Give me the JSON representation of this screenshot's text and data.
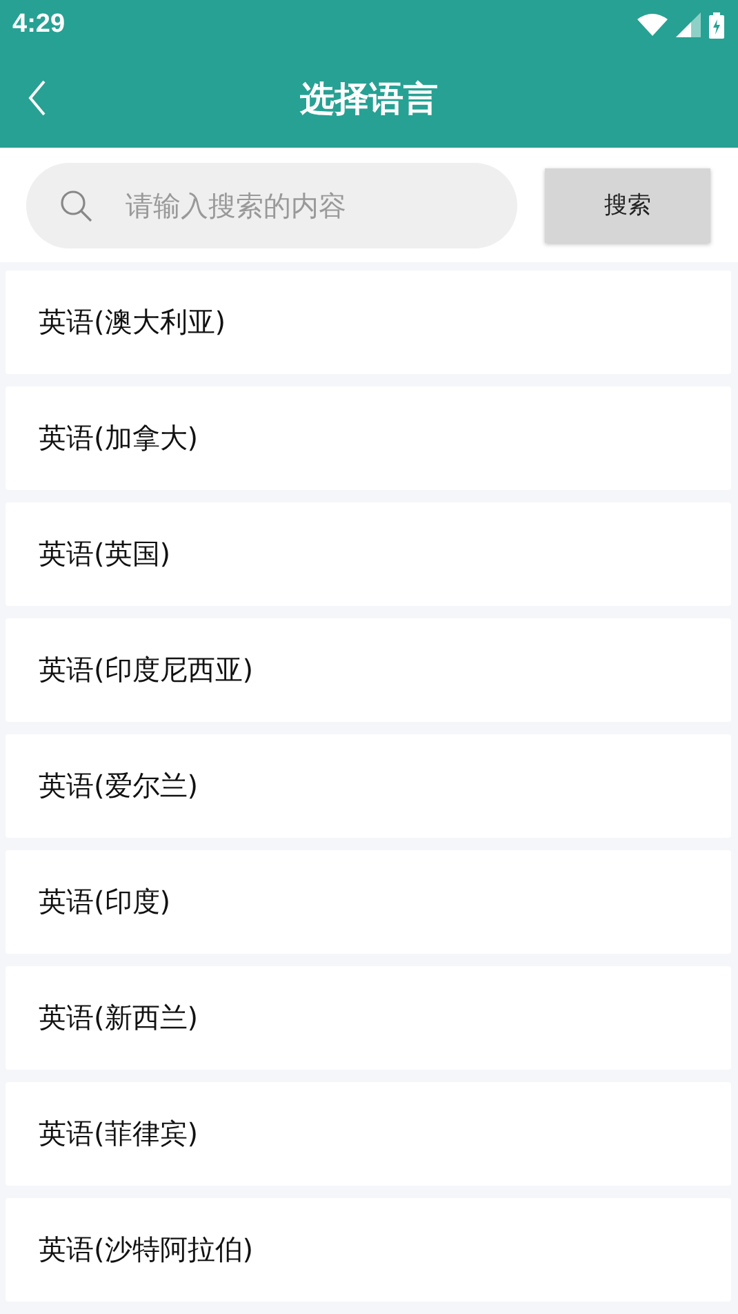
{
  "status_bar": {
    "time": "4:29"
  },
  "header": {
    "title": "选择语言"
  },
  "search": {
    "placeholder": "请输入搜索的内容",
    "button": "搜索"
  },
  "languages": [
    {
      "label": "英语(澳大利亚)"
    },
    {
      "label": "英语(加拿大)"
    },
    {
      "label": "英语(英国)"
    },
    {
      "label": "英语(印度尼西亚)"
    },
    {
      "label": "英语(爱尔兰)"
    },
    {
      "label": "英语(印度)"
    },
    {
      "label": "英语(新西兰)"
    },
    {
      "label": "英语(菲律宾)"
    },
    {
      "label": "英语(沙特阿拉伯)"
    }
  ]
}
